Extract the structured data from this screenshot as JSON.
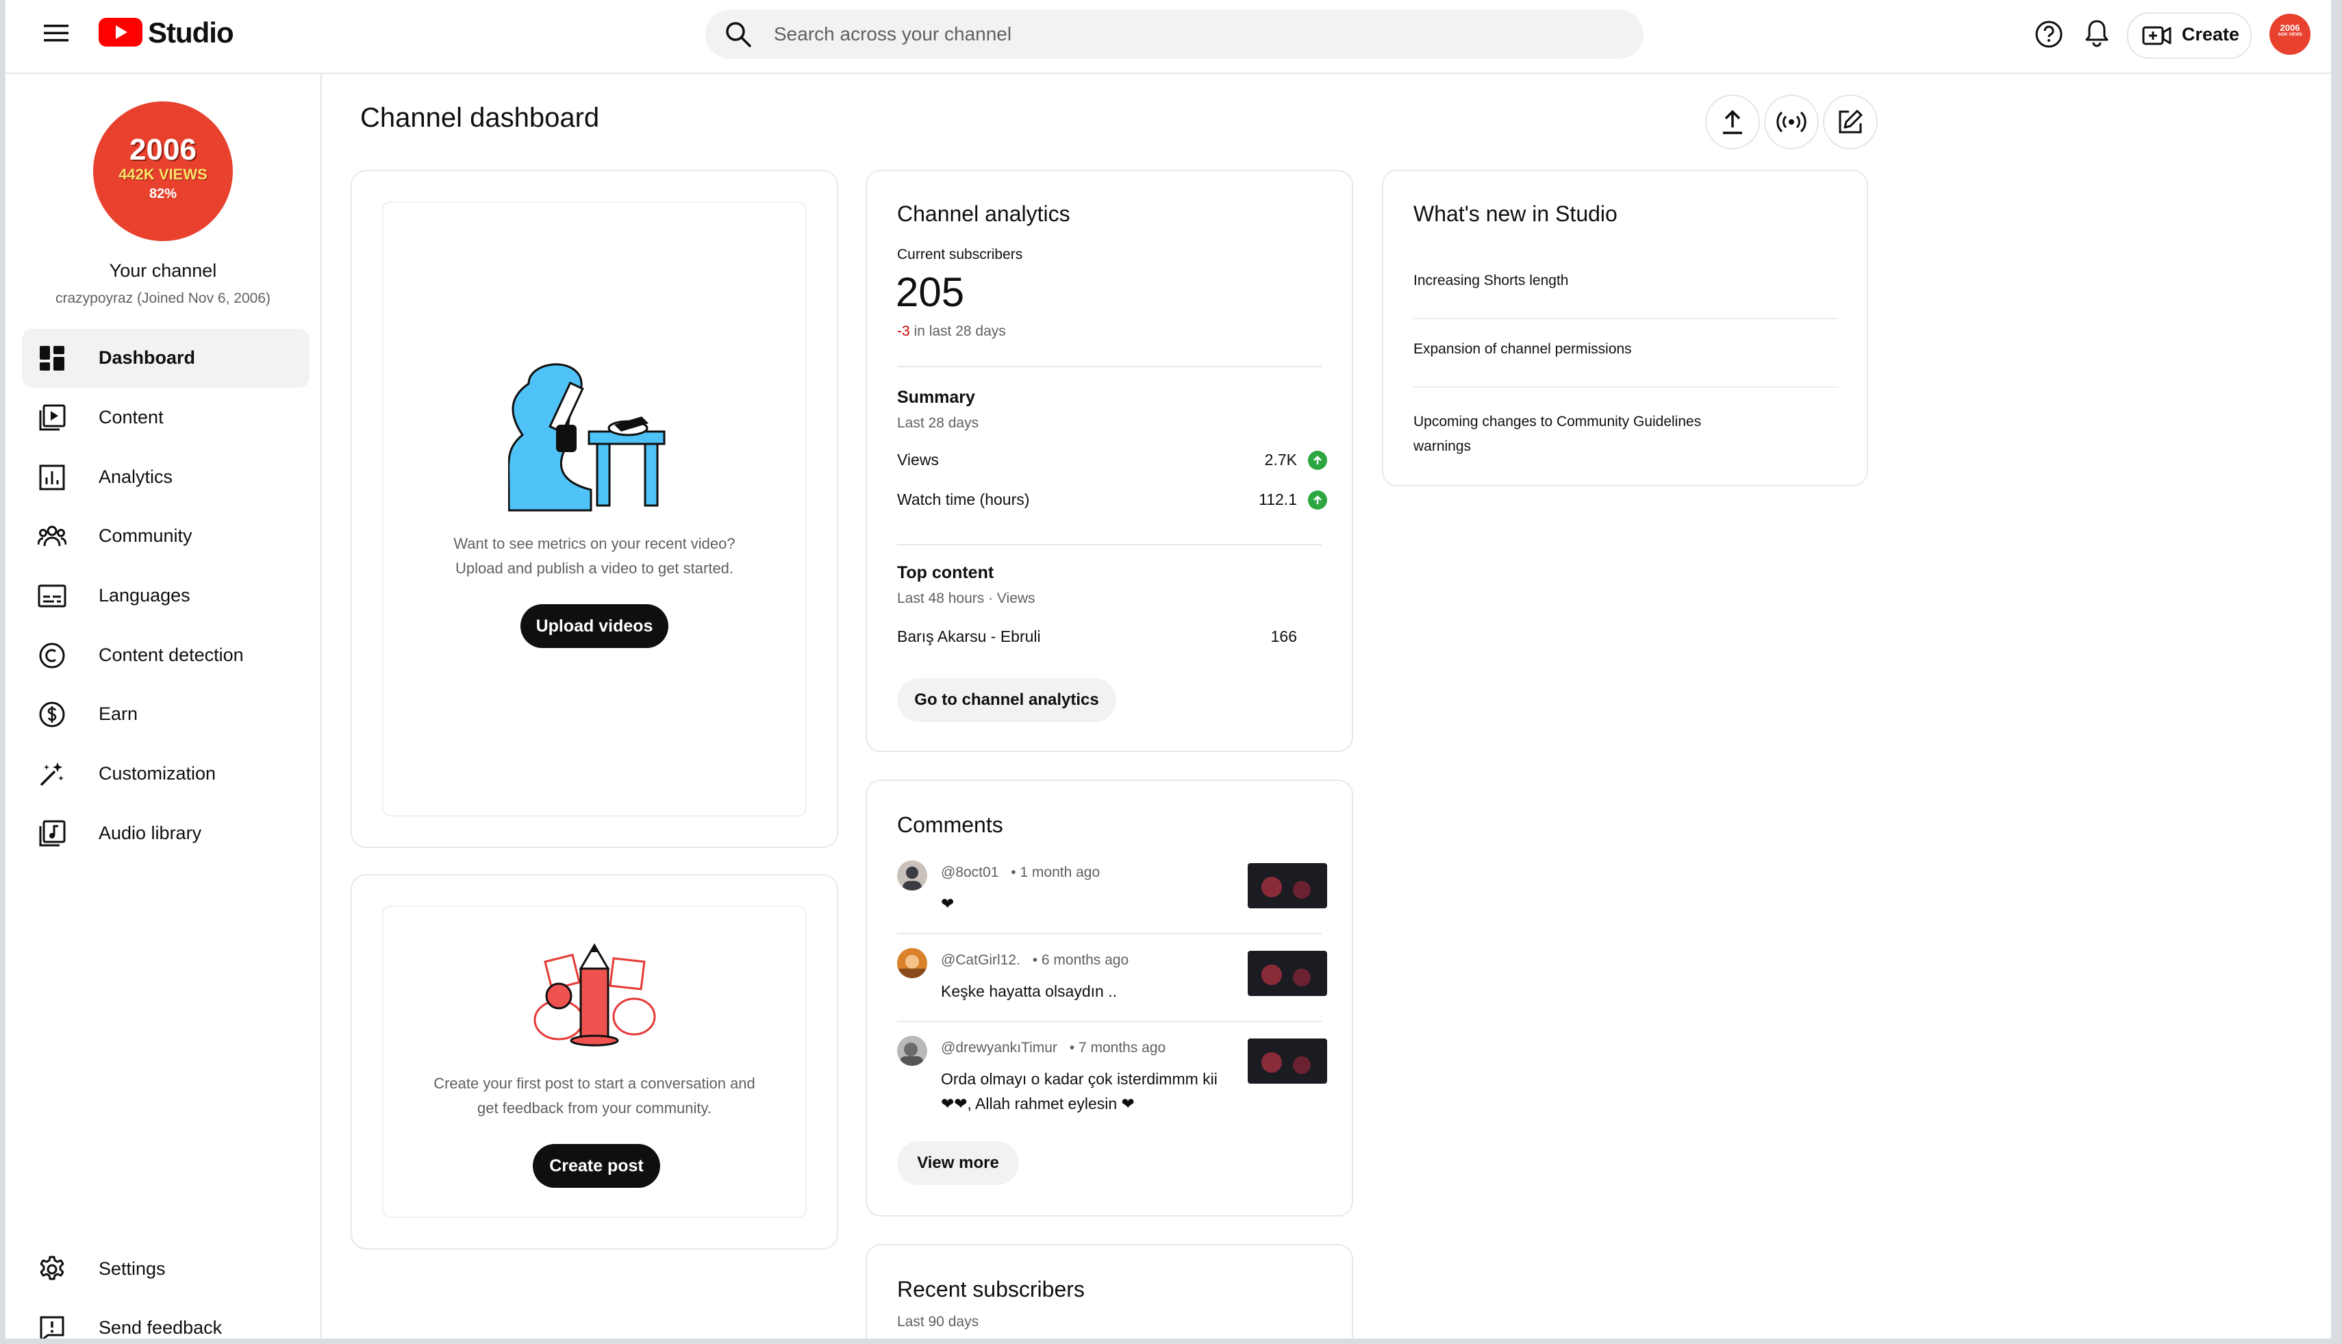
{
  "header": {
    "logo_text": "Studio",
    "search_placeholder": "Search across your channel",
    "create_label": "Create",
    "avatar_badge": {
      "year": "2006",
      "views": "442K VIEWS",
      "pct": "82%"
    }
  },
  "sidebar": {
    "channel_title": "Your channel",
    "channel_handle": "crazypoyraz (Joined Nov 6, 2006)",
    "items": [
      {
        "label": "Dashboard",
        "icon": "dashboard-icon",
        "active": true
      },
      {
        "label": "Content",
        "icon": "content-icon"
      },
      {
        "label": "Analytics",
        "icon": "analytics-icon"
      },
      {
        "label": "Community",
        "icon": "community-icon"
      },
      {
        "label": "Languages",
        "icon": "subtitles-icon"
      },
      {
        "label": "Content detection",
        "icon": "copyright-icon"
      },
      {
        "label": "Earn",
        "icon": "dollar-icon"
      },
      {
        "label": "Customization",
        "icon": "magic-wand-icon"
      },
      {
        "label": "Audio library",
        "icon": "audio-library-icon"
      }
    ],
    "bottom_items": [
      {
        "label": "Settings",
        "icon": "gear-icon"
      },
      {
        "label": "Send feedback",
        "icon": "feedback-icon"
      }
    ]
  },
  "main": {
    "title": "Channel dashboard",
    "upload_card": {
      "text_line1": "Want to see metrics on your recent video?",
      "text_line2": "Upload and publish a video to get started.",
      "button": "Upload videos"
    },
    "post_card": {
      "text_line1": "Create your first post to start a conversation and",
      "text_line2": "get feedback from your community.",
      "button": "Create post"
    },
    "analytics": {
      "title": "Channel analytics",
      "subs_label": "Current subscribers",
      "subs_value": "205",
      "subs_change": "-3",
      "subs_change_suffix": "in last 28 days",
      "summary_title": "Summary",
      "summary_period": "Last 28 days",
      "rows": [
        {
          "label": "Views",
          "value": "2.7K"
        },
        {
          "label": "Watch time (hours)",
          "value": "112.1"
        }
      ],
      "top_title": "Top content",
      "top_period": "Last 48 hours · Views",
      "top_items": [
        {
          "label": "Barış Akarsu - Ebruli",
          "value": "166"
        }
      ],
      "button": "Go to channel analytics"
    },
    "comments": {
      "title": "Comments",
      "items": [
        {
          "author": "@8oct01",
          "time": "• 1 month ago",
          "text1": "❤",
          "text2": ""
        },
        {
          "author": "@CatGirl12.",
          "time": "• 6 months ago",
          "text1": "Keşke hayatta olsaydın ..",
          "text2": ""
        },
        {
          "author": "@drewyankıTimur",
          "time": "• 7 months ago",
          "text1": "Orda olmayı o kadar çok isterdimmm kii",
          "text2": "❤❤, Allah rahmet eylesin ❤"
        }
      ],
      "button": "View more"
    },
    "recent_subscribers": {
      "title": "Recent subscribers",
      "period": "Last 90 days"
    },
    "whats_new": {
      "title": "What's new in Studio",
      "items": [
        {
          "line1": "Increasing Shorts length",
          "line2": ""
        },
        {
          "line1": "Expansion of channel permissions",
          "line2": ""
        },
        {
          "line1": "Upcoming changes to Community Guidelines",
          "line2": "warnings"
        }
      ]
    }
  }
}
